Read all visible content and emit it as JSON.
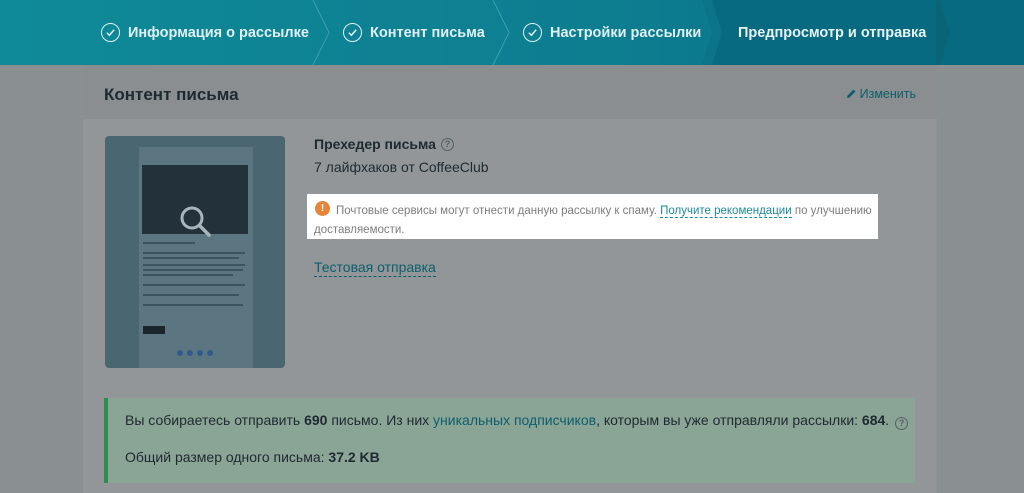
{
  "wizard": {
    "steps": [
      {
        "label": "Информация о рассылке",
        "done": true
      },
      {
        "label": "Контент письма",
        "done": true
      },
      {
        "label": "Настройки рассылки",
        "done": true
      },
      {
        "label": "Предпросмотр и отправка",
        "done": false,
        "active": true
      }
    ]
  },
  "card": {
    "title": "Контент письма",
    "edit_label": "Изменить"
  },
  "preheader": {
    "label": "Прехедер письма",
    "value": "7 лайфхаков от CoffeeClub"
  },
  "warning": {
    "text_before": "Почтовые сервисы могут отнести данную рассылку к спаму.",
    "link": "Получите рекомендации",
    "text_after": "по улучшению доставляемости."
  },
  "test_send_label": "Тестовая отправка",
  "summary": {
    "line1_a": "Вы собираетесь отправить",
    "count": "690",
    "line1_b": "письмо.  Из них",
    "unique_link": "уникальных подписчиков",
    "line1_c": ", которым вы уже отправляли рассылки:",
    "unique_count": "684",
    "line2_a": "Общий размер одного письма:",
    "size": "37.2 KB"
  },
  "colors": {
    "accent": "#0d7d90",
    "success": "#2e8c52",
    "warning": "#e8843a"
  }
}
